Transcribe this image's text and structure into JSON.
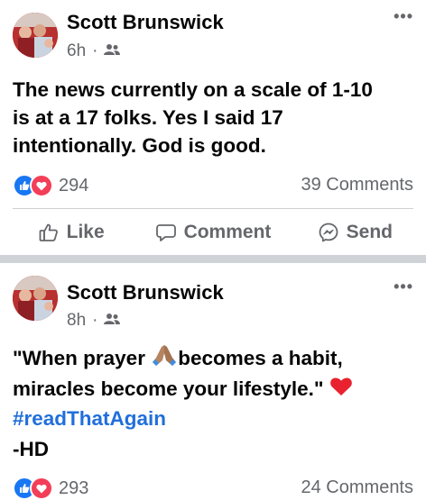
{
  "posts": [
    {
      "author": "Scott Brunswick",
      "time": "6h",
      "audience_icon": "friends-icon",
      "text_lines": [
        "The news currently on a scale of 1-10",
        "is at a 17 folks. Yes I said 17",
        "intentionally. God is good."
      ],
      "reaction_count": "294",
      "comments": "39 Comments",
      "actions": {
        "like": "Like",
        "comment": "Comment",
        "send": "Send"
      }
    },
    {
      "author": "Scott Brunswick",
      "time": "8h",
      "audience_icon": "friends-icon",
      "text_part1": "\"When prayer",
      "text_part2": "becomes a habit,",
      "text_line2": "miracles become your lifestyle.\"",
      "hashtag": "#readThatAgain",
      "signature": "-HD",
      "reaction_count": "293",
      "comments": "24 Comments"
    }
  ],
  "more_label": "•••",
  "dot": "·",
  "colors": {
    "like_blue": "#1877f2",
    "love_red": "#f33e58",
    "hashtag_blue": "#216fdb",
    "meta_gray": "#65676b",
    "separator": "#cfd3d8"
  }
}
